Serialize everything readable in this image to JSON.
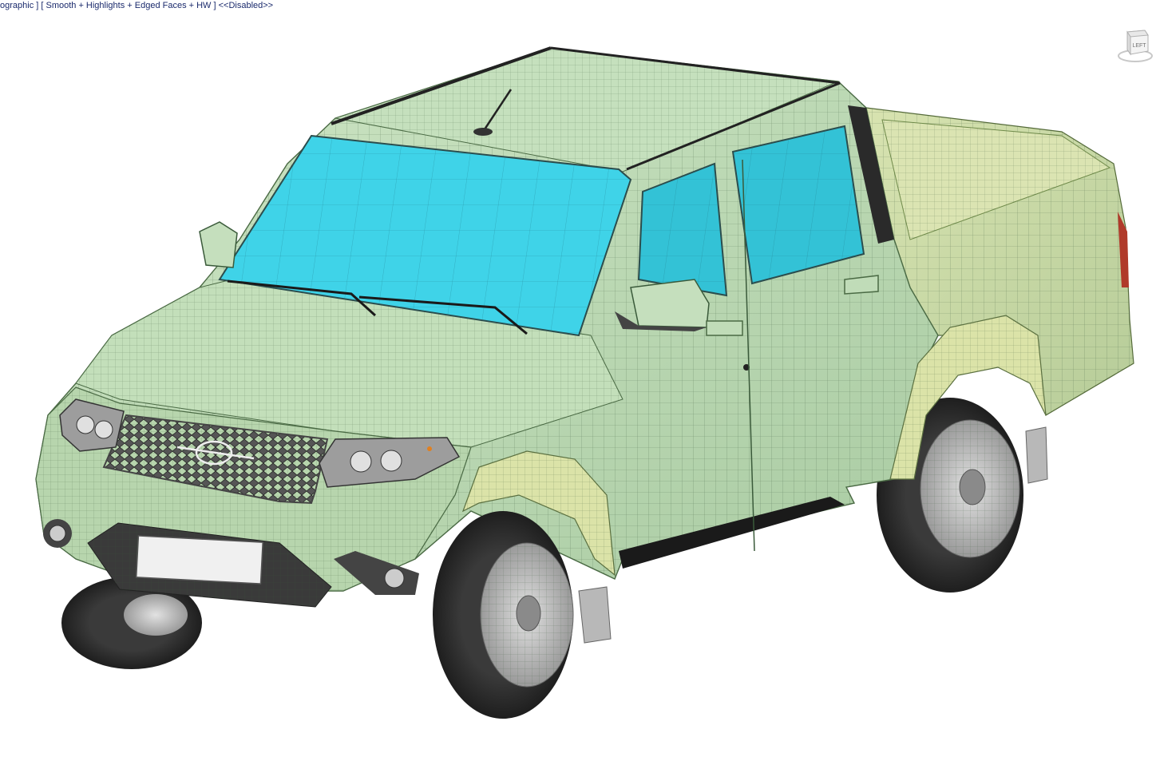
{
  "viewport": {
    "label": "ographic ] [ Smooth + Highlights + Edged Faces + HW ] <<Disabled>>"
  },
  "viewcube": {
    "face_label": "LEFT",
    "icon": "viewcube-icon"
  },
  "model": {
    "icon": "pickup-truck-mesh",
    "colors": {
      "body": "#b9d6b0",
      "body_shade": "#9fc49a",
      "glass": "#3fd3e8",
      "fender": "#d9e2a6",
      "tire": "#2a2a2a",
      "rim": "#bcbcbc",
      "wire": "#3c5a3c"
    }
  }
}
